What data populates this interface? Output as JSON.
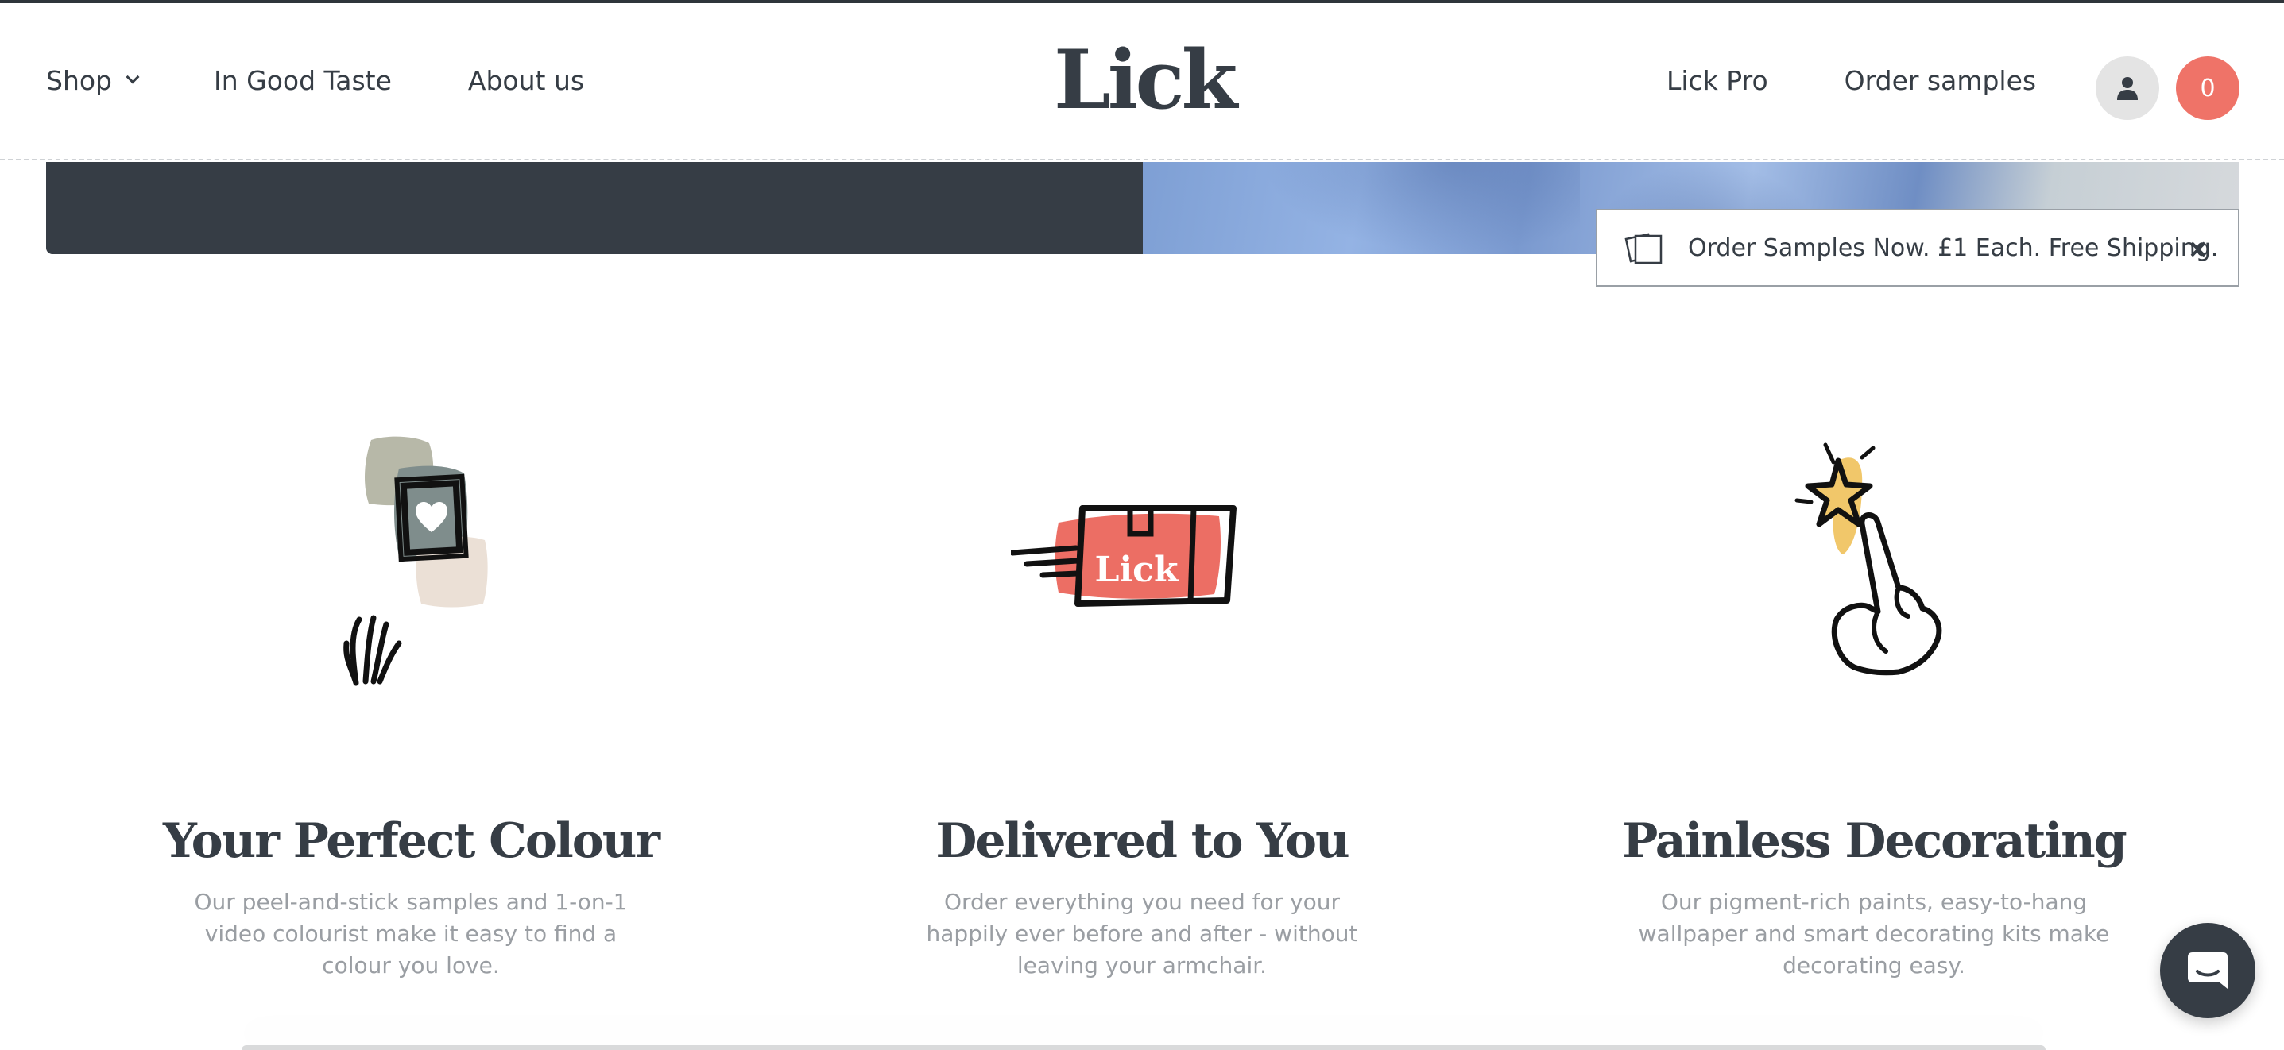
{
  "header": {
    "nav_left": [
      {
        "label": "Shop",
        "has_dropdown": true
      },
      {
        "label": "In Good Taste"
      },
      {
        "label": "About us"
      }
    ],
    "logo": "Lick",
    "nav_right": [
      {
        "label": "Lick Pro"
      },
      {
        "label": "Order samples"
      }
    ],
    "account_icon": "user-icon",
    "cart_count": "0"
  },
  "toast": {
    "icon": "sample-cards-icon",
    "text": "Order Samples Now. £1 Each. Free Shipping.",
    "close_label": "×"
  },
  "features": [
    {
      "icon": "colour-swatch-hand-illustration",
      "title": "Your Perfect Colour",
      "text": "Our peel-and-stick samples and 1-on-1 video colourist make it easy to find a colour you love."
    },
    {
      "icon": "delivery-box-illustration",
      "box_label": "Lick",
      "title": "Delivered to You",
      "text": "Order everything you need for your happily ever before and after - without leaving your armchair."
    },
    {
      "icon": "star-hand-illustration",
      "title": "Painless Decorating",
      "text": "Our pigment-rich paints, easy-to-hang wallpaper and smart decorating kits make decorating easy."
    }
  ],
  "colors": {
    "ink": "#363d45",
    "accent": "#ef7368",
    "muted_text": "#9a9ea3"
  },
  "chat_icon": "chat-bubble-icon"
}
